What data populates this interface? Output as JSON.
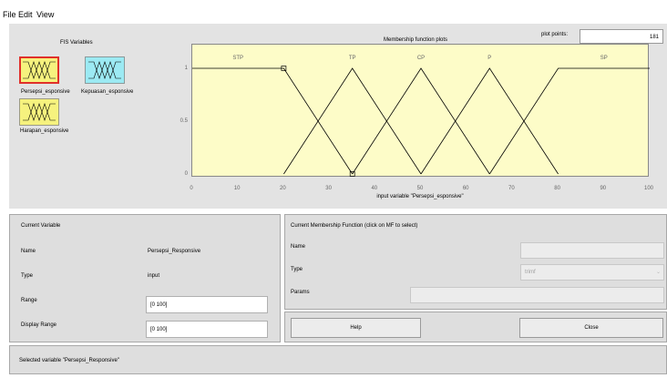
{
  "menu": {
    "file": "File",
    "edit": "Edit",
    "view": "View"
  },
  "fis": {
    "title": "FIS Variables",
    "vars": [
      {
        "name": "Persepsi_esponsive",
        "color": "#f6f27e",
        "selected": true
      },
      {
        "name": "Kepuasan_esponsive",
        "color": "#9ceaf3",
        "selected": false
      },
      {
        "name": "Harapan_esponsive",
        "color": "#f6f27e",
        "selected": false
      }
    ]
  },
  "plot": {
    "title": "Membership function plots",
    "points_label": "plot points:",
    "points_value": "181",
    "xlabel": "input variable \"Persepsi_esponsive\"",
    "mf_labels": [
      "STP",
      "TP",
      "CP",
      "P",
      "SP"
    ],
    "y_ticks": [
      "1",
      "0.5",
      "0"
    ],
    "x_ticks": [
      "0",
      "10",
      "20",
      "30",
      "40",
      "50",
      "60",
      "70",
      "80",
      "90",
      "100"
    ]
  },
  "chart_data": {
    "type": "line",
    "title": "Membership function plots",
    "xlabel": "input variable \"Persepsi_esponsive\"",
    "ylabel": "",
    "xlim": [
      0,
      100
    ],
    "ylim": [
      0,
      1
    ],
    "series": [
      {
        "name": "STP",
        "x": [
          0,
          20,
          35
        ],
        "y": [
          1,
          1,
          0
        ]
      },
      {
        "name": "TP",
        "x": [
          20,
          35,
          50
        ],
        "y": [
          0,
          1,
          0
        ]
      },
      {
        "name": "CP",
        "x": [
          35,
          50,
          65
        ],
        "y": [
          0,
          1,
          0
        ]
      },
      {
        "name": "P",
        "x": [
          50,
          65,
          80
        ],
        "y": [
          0,
          1,
          0
        ]
      },
      {
        "name": "SP",
        "x": [
          65,
          80,
          100
        ],
        "y": [
          0,
          1,
          1
        ]
      }
    ]
  },
  "current_variable": {
    "title": "Current Variable",
    "name_label": "Name",
    "name_value": "Persepsi_Responsive",
    "type_label": "Type",
    "type_value": "input",
    "range_label": "Range",
    "range_value": "[0 100]",
    "display_range_label": "Display Range",
    "display_range_value": "[0 100]"
  },
  "current_mf": {
    "title": "Current Membership Function (click on MF to select)",
    "name_label": "Name",
    "name_value": "",
    "type_label": "Type",
    "type_value": "trimf",
    "params_label": "Params",
    "params_value": ""
  },
  "buttons": {
    "help": "Help",
    "close": "Close"
  },
  "status": "Selected variable \"Persepsi_Responsive\""
}
